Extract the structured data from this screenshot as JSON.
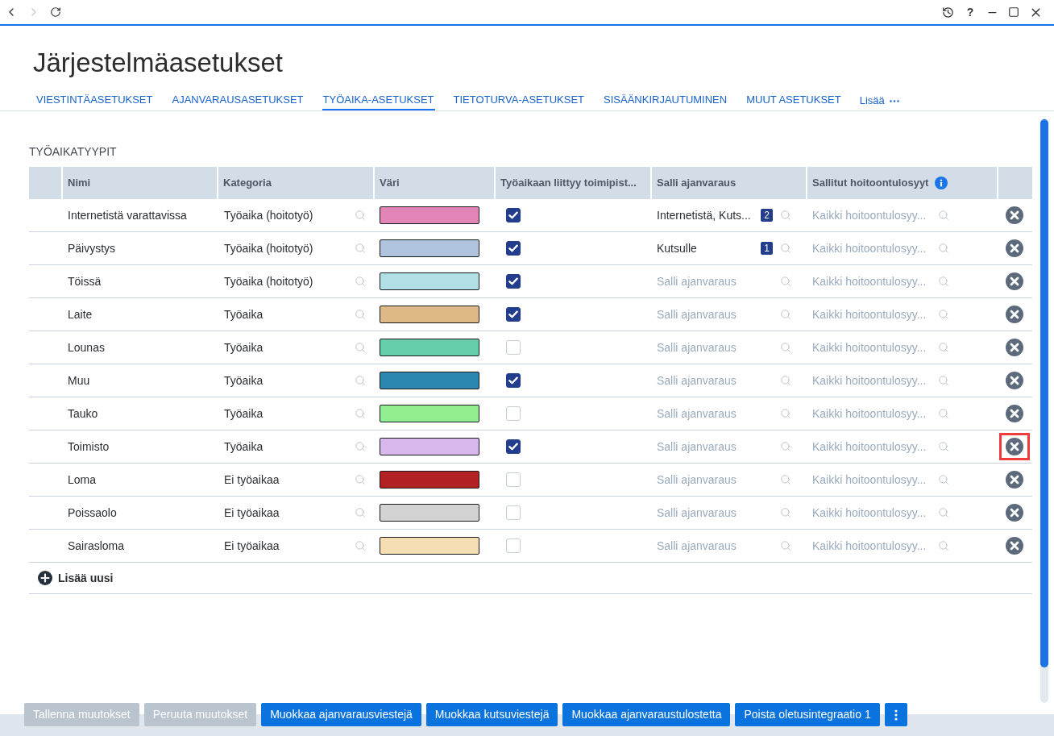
{
  "nav": [
    {
      "kind": "back",
      "disabled": false
    },
    {
      "kind": "forward",
      "disabled": true
    },
    {
      "kind": "reload",
      "disabled": false
    }
  ],
  "window_controls": [
    {
      "kind": "history"
    },
    {
      "kind": "help",
      "label": "?"
    },
    {
      "kind": "minimize"
    },
    {
      "kind": "maximize"
    },
    {
      "kind": "close"
    }
  ],
  "page": {
    "title": "Järjestelmäasetukset"
  },
  "tabs": [
    {
      "label": "VIESTINTÄASETUKSET",
      "selected": false
    },
    {
      "label": "AJANVARAUSASETUKSET",
      "selected": false
    },
    {
      "label": "TYÖAIKA-ASETUKSET",
      "selected": true
    },
    {
      "label": "TIETOTURVA-ASETUKSET",
      "selected": false
    },
    {
      "label": "SISÄÄNKIRJAUTUMINEN",
      "selected": false
    },
    {
      "label": "MUUT ASETUKSET",
      "selected": false
    }
  ],
  "more_tab": {
    "label": "Lisää"
  },
  "section": {
    "title": "TYÖAIKATYYPIT"
  },
  "table": {
    "columns": [
      {
        "label": "Nimi",
        "info": false
      },
      {
        "label": "Kategoria",
        "info": false
      },
      {
        "label": "Väri",
        "info": false
      },
      {
        "label": "Työaikaan liittyy toimipist...",
        "info": false
      },
      {
        "label": "Salli ajanvaraus",
        "info": false
      },
      {
        "label": "Sallitut hoitoontulosyyt",
        "info": true
      }
    ],
    "rows": [
      {
        "name": "Internetistä varattavissa",
        "category": "Työaika (hoitotyö)",
        "color": "#e085b5",
        "checked": true,
        "booking": {
          "value": "Internetistä, Kuts...",
          "count": "2"
        },
        "reasons_placeholder": "Kaikki hoitoontulosyy...",
        "highlighted": false
      },
      {
        "name": "Päivystys",
        "category": "Työaika (hoitotyö)",
        "color": "#b0c4de",
        "checked": true,
        "booking": {
          "value": "Kutsulle",
          "count": "1"
        },
        "reasons_placeholder": "Kaikki hoitoontulosyy...",
        "highlighted": false
      },
      {
        "name": "Töissä",
        "category": "Työaika (hoitotyö)",
        "color": "#b0e0e6",
        "checked": true,
        "booking": {
          "placeholder": "Salli ajanvaraus"
        },
        "reasons_placeholder": "Kaikki hoitoontulosyy...",
        "highlighted": false
      },
      {
        "name": "Laite",
        "category": "Työaika",
        "color": "#deb887",
        "checked": true,
        "booking": {
          "placeholder": "Salli ajanvaraus"
        },
        "reasons_placeholder": "Kaikki hoitoontulosyy...",
        "highlighted": false
      },
      {
        "name": "Lounas",
        "category": "Työaika",
        "color": "#66cdaa",
        "checked": false,
        "booking": {
          "placeholder": "Salli ajanvaraus"
        },
        "reasons_placeholder": "Kaikki hoitoontulosyy...",
        "highlighted": false
      },
      {
        "name": "Muu",
        "category": "Työaika",
        "color": "#2a87b0",
        "checked": true,
        "booking": {
          "placeholder": "Salli ajanvaraus"
        },
        "reasons_placeholder": "Kaikki hoitoontulosyy...",
        "highlighted": false
      },
      {
        "name": "Tauko",
        "category": "Työaika",
        "color": "#90ee90",
        "checked": false,
        "booking": {
          "placeholder": "Salli ajanvaraus"
        },
        "reasons_placeholder": "Kaikki hoitoontulosyy...",
        "highlighted": false
      },
      {
        "name": "Toimisto",
        "category": "Työaika",
        "color": "#d8b8ec",
        "checked": true,
        "booking": {
          "placeholder": "Salli ajanvaraus"
        },
        "reasons_placeholder": "Kaikki hoitoontulosyy...",
        "highlighted": true
      },
      {
        "name": "Loma",
        "category": "Ei työaikaa",
        "color": "#b22222",
        "checked": false,
        "booking": {
          "placeholder": "Salli ajanvaraus"
        },
        "reasons_placeholder": "Kaikki hoitoontulosyy...",
        "highlighted": false
      },
      {
        "name": "Poissaolo",
        "category": "Ei työaikaa",
        "color": "#d3d3d3",
        "checked": false,
        "booking": {
          "placeholder": "Salli ajanvaraus"
        },
        "reasons_placeholder": "Kaikki hoitoontulosyy...",
        "highlighted": false
      },
      {
        "name": "Sairasloma",
        "category": "Ei työaikaa",
        "color": "#f5deb3",
        "checked": false,
        "booking": {
          "placeholder": "Salli ajanvaraus"
        },
        "reasons_placeholder": "Kaikki hoitoontulosyy...",
        "highlighted": false
      }
    ],
    "add_label": "Lisää uusi"
  },
  "buttons": [
    {
      "kind": "text",
      "label": "Tallenna muutokset",
      "disabled": true
    },
    {
      "kind": "text",
      "label": "Peruuta muutokset",
      "disabled": true
    },
    {
      "kind": "text",
      "label": "Muokkaa ajanvarausviestejä",
      "disabled": false
    },
    {
      "kind": "text",
      "label": "Muokkaa kutsuviestejä",
      "disabled": false
    },
    {
      "kind": "text",
      "label": "Muokkaa ajanvaraustulostetta",
      "disabled": false
    },
    {
      "kind": "text",
      "label": "Poista oletusintegraatio 1",
      "disabled": false
    },
    {
      "kind": "menu",
      "disabled": false
    }
  ]
}
